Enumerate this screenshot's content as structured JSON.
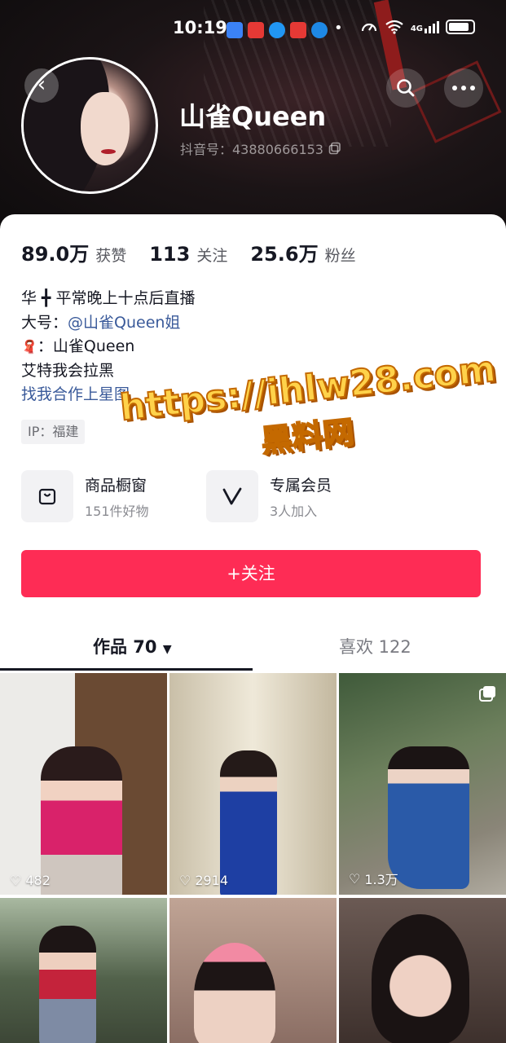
{
  "status_bar": {
    "time": "10:19",
    "network": "4G"
  },
  "profile": {
    "name": "山雀Queen",
    "douyin_id": "抖音号：43880666153"
  },
  "stats": [
    {
      "value": "89.0万",
      "label": "获赞"
    },
    {
      "value": "113",
      "label": "关注"
    },
    {
      "value": "25.6万",
      "label": "粉丝"
    }
  ],
  "bio": {
    "line1": "华 ╋ 平常晚上十点后直播",
    "line2_prefix": "大号：",
    "line2_mention": "@山雀Queen姐",
    "line3_icon": "🧣",
    "line3_text": "：山雀Queen",
    "line4": "艾特我会拉黑",
    "line5": "找我合作上星图",
    "ip": "IP：福建"
  },
  "watermark": {
    "line1": "https://ihlw28.com",
    "line2": "黑料网"
  },
  "features": [
    {
      "icon": "shopping-bag-icon",
      "title": "商品橱窗",
      "sub": "151件好物"
    },
    {
      "icon": "vip-v-icon",
      "title": "专属会员",
      "sub": "3人加入"
    }
  ],
  "follow_button": "+关注",
  "tabs": [
    {
      "label": "作品 70",
      "active": true
    },
    {
      "label": "喜欢 122",
      "active": false
    }
  ],
  "videos": [
    {
      "likes": "482"
    },
    {
      "likes": "2914"
    },
    {
      "likes": "1.3万"
    },
    {
      "likes": ""
    },
    {
      "likes": ""
    },
    {
      "likes": ""
    }
  ],
  "colors": {
    "accent": "#fe2c55",
    "link": "#3a5a9a",
    "text": "#161823"
  }
}
